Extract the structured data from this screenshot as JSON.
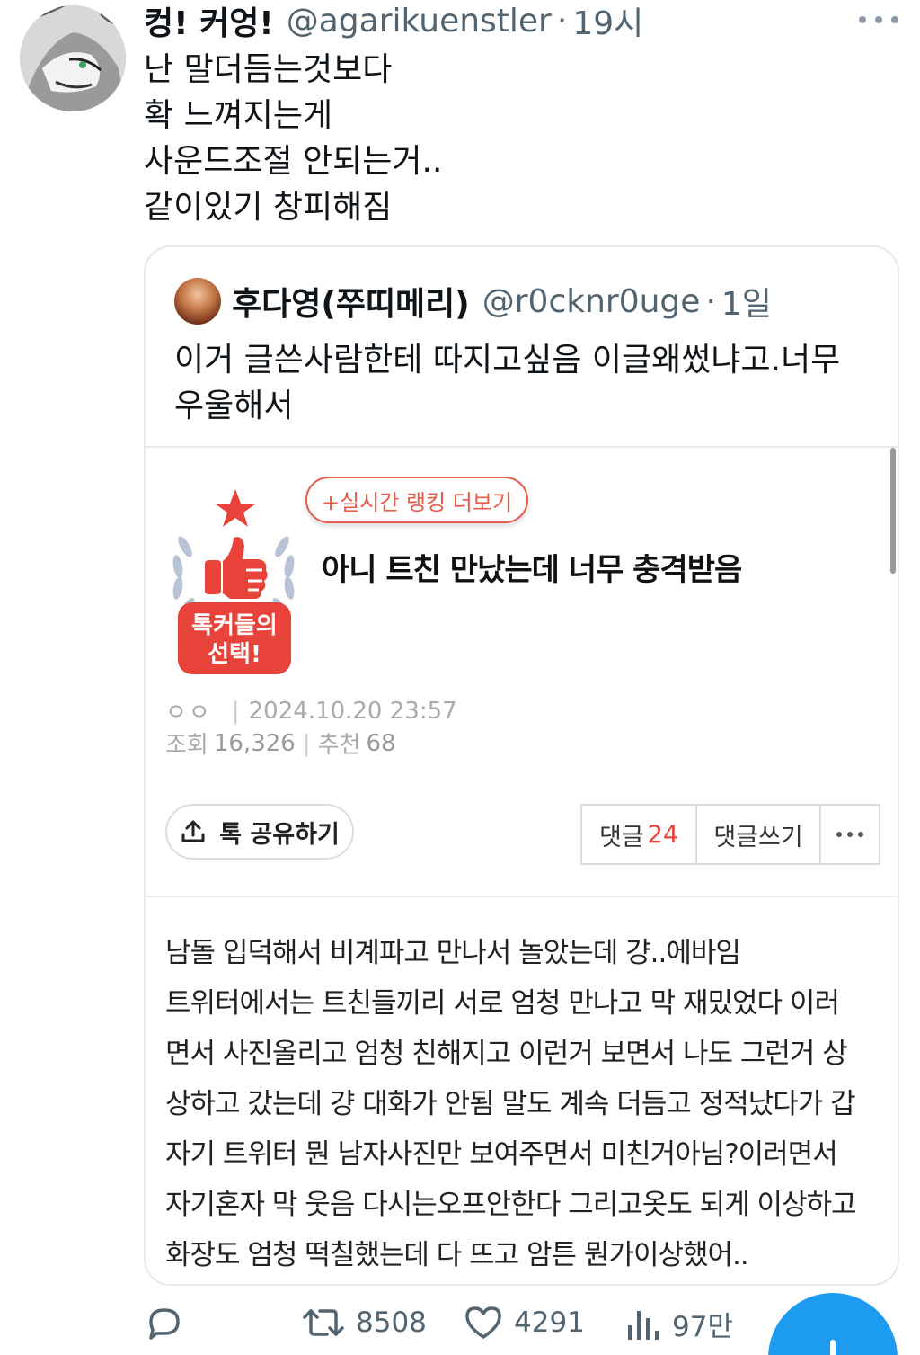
{
  "tweet": {
    "name": "컹! 커엉!",
    "handle": "@agarikuenstler",
    "separator": "·",
    "time": "19시",
    "lines": [
      "난 말더듬는것보다",
      "확 느껴지는게",
      "사운드조절 안되는거..",
      "같이있기 창피해짐"
    ]
  },
  "quote": {
    "name": "후다영(쭈띠메리)",
    "handle": "@r0cknr0uge",
    "separator": "·",
    "time": "1일",
    "text": "이거 글쓴사람한테 따지고싶음 이글왜썼냐고.너무 우울해서"
  },
  "embed": {
    "badge_line1": "톡커들의",
    "badge_line2": "선택!",
    "rank_button": "+실시간 랭킹 더보기",
    "post_title": "아니 트친 만났는데 너무 충격받음",
    "author": "ㅇㅇ",
    "date": "2024.10.20 23:57",
    "views_label": "조회",
    "views": "16,326",
    "recommend_label": "추천",
    "recommend": "68",
    "share_label": "톡 공유하기",
    "comment_label": "댓글",
    "comment_count": "24",
    "write_comment_label": "댓글쓰기",
    "body_lines": [
      "남돌 입덕해서 비계파고 만나서 놀았는데 걍..에바임",
      "트위터에서는 트친들끼리 서로 엄청 만나고 막 재밌었다 이러",
      "면서 사진올리고 엄청 친해지고 이런거 보면서 나도 그런거 상",
      "상하고 갔는데 걍 대화가 안됨 말도 계속 더듬고 정적났다가 갑",
      "자기 트위터 뭔 남자사진만 보여주면서 미친거아님?이러면서",
      "자기혼자 막 웃음 다시는오프안한다 그리고옷도 되게 이상하고",
      "화장도 엄청 떡칠했는데 다 뜨고 암튼 뭔가이상했어.."
    ]
  },
  "actions": {
    "retweets": "8508",
    "likes": "4291",
    "views": "97만"
  },
  "icons": [
    "more-icon",
    "reply-icon",
    "retweet-icon",
    "like-icon",
    "views-icon",
    "share-upload-icon",
    "compose-icon"
  ],
  "colors": {
    "accent": "#1d9bf0",
    "badge_red": "#e8433a",
    "muted": "#536471"
  }
}
